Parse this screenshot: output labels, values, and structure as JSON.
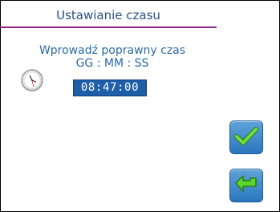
{
  "header": {
    "title": "Ustawianie czasu"
  },
  "main": {
    "prompt": "Wprowadź poprawny czas",
    "format": "GG : MM : SS",
    "time_value": "08:47:00"
  },
  "icons": {
    "clock": "clock-icon",
    "ok": "checkmark-icon",
    "back": "back-arrow-icon"
  },
  "colors": {
    "title_text": "#2a4f86",
    "title_rule": "#8a2386",
    "time_box": "#1f5fa8",
    "accent_green": "#48c41e"
  }
}
